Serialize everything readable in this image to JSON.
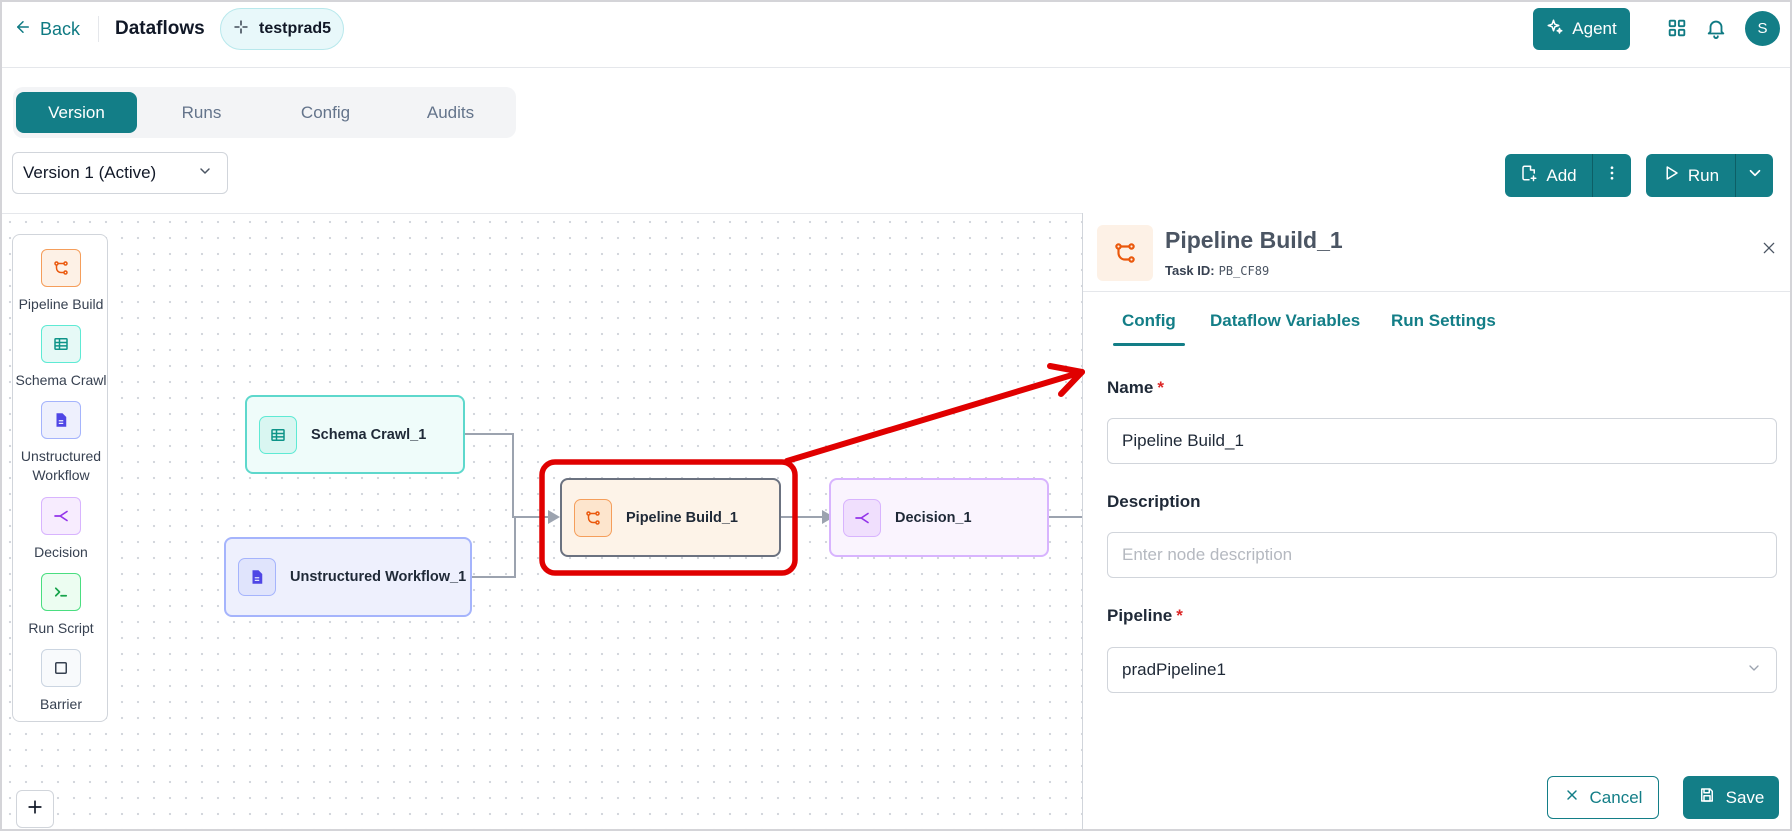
{
  "header": {
    "back_label": "Back",
    "app_title": "Dataflows",
    "dataflow_name": "testprad5",
    "agent_label": "Agent",
    "avatar_initial": "S"
  },
  "tabs": [
    {
      "label": "Version",
      "active": true
    },
    {
      "label": "Runs",
      "active": false
    },
    {
      "label": "Config",
      "active": false
    },
    {
      "label": "Audits",
      "active": false
    }
  ],
  "version_select": {
    "value": "Version 1 (Active)"
  },
  "toolbar": {
    "add_label": "Add",
    "run_label": "Run"
  },
  "palette": [
    {
      "label": "Pipeline Build",
      "icon": "pipeline-icon"
    },
    {
      "label": "Schema Crawl",
      "icon": "table-icon"
    },
    {
      "label": "Unstructured Workflow",
      "icon": "document-icon"
    },
    {
      "label": "Decision",
      "icon": "decision-icon"
    },
    {
      "label": "Run Script",
      "icon": "terminal-icon"
    },
    {
      "label": "Barrier",
      "icon": "square-icon"
    }
  ],
  "nodes": {
    "schema_crawl": "Schema Crawl_1",
    "unstructured": "Unstructured Workflow_1",
    "pipeline": "Pipeline Build_1",
    "decision": "Decision_1"
  },
  "panel": {
    "title": "Pipeline Build_1",
    "task_id_label": "Task ID:",
    "task_id_value": "PB_CF89",
    "tabs": [
      "Config",
      "Dataflow Variables",
      "Run Settings"
    ],
    "name_label": "Name",
    "name_value": "Pipeline Build_1",
    "description_label": "Description",
    "description_placeholder": "Enter node description",
    "pipeline_label": "Pipeline",
    "pipeline_value": "pradPipeline1",
    "required_mark": "*",
    "cancel_label": "Cancel",
    "save_label": "Save"
  },
  "colors": {
    "primary": "#137e87",
    "pipeline": "#ea580c",
    "schema": "#14b8a6",
    "unstructured": "#4f46e5",
    "decision": "#9333ea",
    "run_script": "#16a34a",
    "annotation": "#e00000"
  }
}
